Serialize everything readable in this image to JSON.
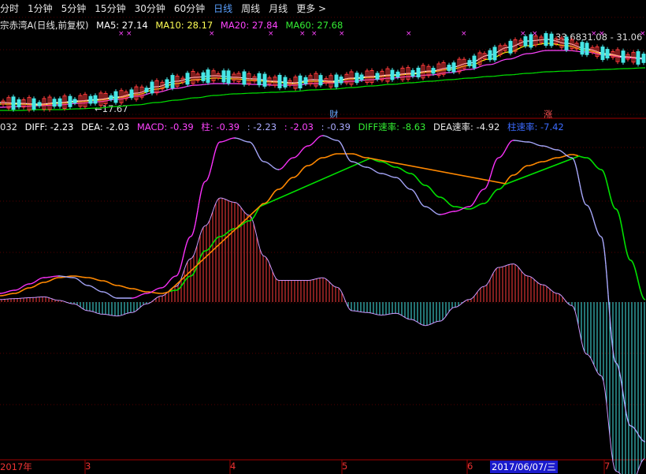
{
  "period_bar": {
    "items": [
      "分时",
      "1分钟",
      "5分钟",
      "15分钟",
      "30分钟",
      "60分钟",
      "日线",
      "周线",
      "月线",
      "更多 >"
    ],
    "active": "日线"
  },
  "kline_legend": {
    "title": "宗赤湾A(日线,前复权)",
    "ma5": "MA5: 27.14",
    "ma10": "MA10: 28.17",
    "ma20": "MA20: 27.84",
    "ma60": "MA60: 27.68"
  },
  "kline_annotations": {
    "low_marker": "←17.67",
    "high_marker": "33.68",
    "range_text": "31.08 - 31.06",
    "finance_tag": "财",
    "rise_tag": "涨"
  },
  "macd_legend": {
    "prefix": "032",
    "diff": "DIFF: -2.23",
    "dea": "DEA: -2.03",
    "macd": "MACD: -0.39",
    "zhu": "柱: -0.39",
    "v1": ": -2.23",
    "v2": ": -2.03",
    "v3": ": -0.39",
    "diff_rate": "DIFF速率: -8.63",
    "dea_rate": "DEA速率: -4.92",
    "zhu_rate": "柱速率: -7.42"
  },
  "date_axis": {
    "labels": [
      "2017年",
      "3",
      "4",
      "5",
      "6",
      "2017/06/07/三",
      "7"
    ],
    "highlighted": "2017/06/07/三"
  },
  "colors": {
    "up": "#ff3b3b",
    "down": "#46e6e6",
    "ma5": "#ffffff",
    "ma10": "#ffff00",
    "ma20": "#ff44ff",
    "ma60": "#00e000",
    "diff": "#ffffff",
    "dea": "#ff8800",
    "axis": "#a00000",
    "active_tab": "#5aa0ff"
  },
  "icons": [
    "x-marker-icon"
  ]
}
